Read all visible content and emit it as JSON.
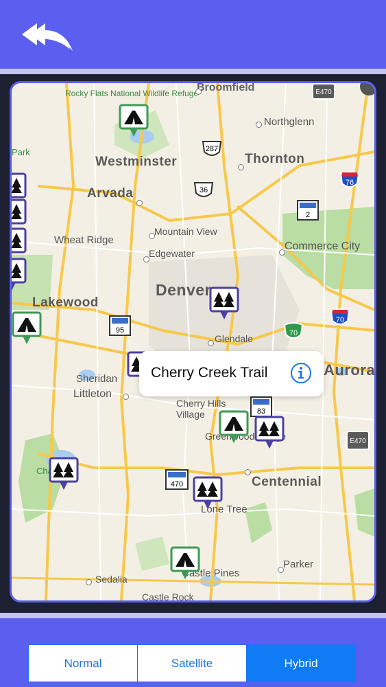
{
  "header": {
    "back_icon": "double-back-arrow-icon"
  },
  "map": {
    "cities": [
      "Westminster",
      "Arvada",
      "Thornton",
      "Lakewood",
      "Denver",
      "Commerce City",
      "Centennial",
      "Northglenn",
      "Broomfield",
      "Aurora"
    ],
    "towns": [
      "Wheat Ridge",
      "Edgewater",
      "Mountain View",
      "Glendale",
      "Sheridan",
      "Littleton",
      "Cherry Hills Village",
      "Greenwood Village",
      "Lone Tree",
      "Parker",
      "Sedalia",
      "Castle Pines",
      "Castle Rock"
    ],
    "parks": [
      "Rocky Flats National Wildlife Refuge",
      "Chatfield",
      "Park"
    ],
    "route_shields": [
      "287",
      "36",
      "76",
      "2",
      "95",
      "70",
      "70",
      "83",
      "470",
      "E470",
      "E470"
    ],
    "pins": [
      {
        "kind": "campground",
        "color": "#3d9a55"
      },
      {
        "kind": "forest",
        "color": "#4b3fa6"
      }
    ]
  },
  "callout": {
    "title": "Cherry Creek Trail",
    "info_icon": "info-icon"
  },
  "map_type": {
    "options": [
      "Normal",
      "Satellite",
      "Hybrid"
    ],
    "selected": "Hybrid"
  }
}
